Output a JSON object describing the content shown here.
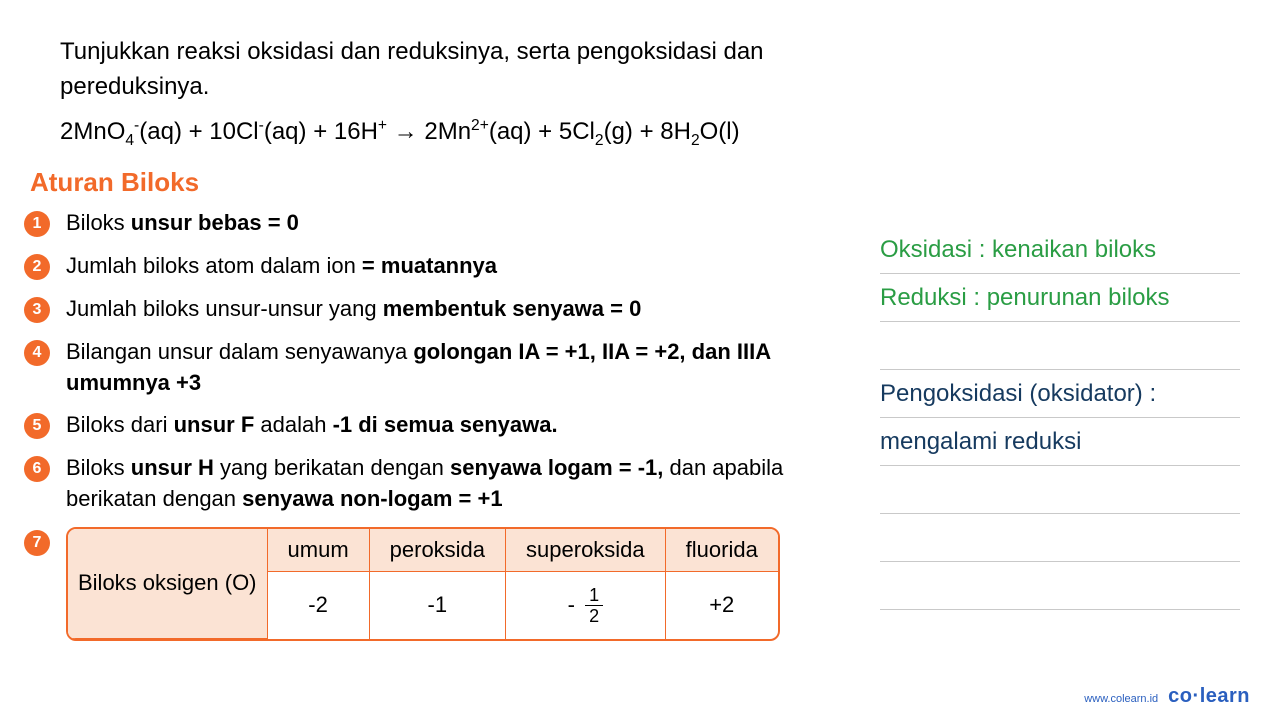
{
  "question": {
    "prompt": "Tunjukkan reaksi oksidasi dan reduksinya, serta pengoksidasi dan pereduksinya.",
    "equation_html": "2MnO<span class='sub'>4</span><span class='sup'>-</span>(aq) + 10Cl<span class='sup'>-</span>(aq) + 16H<span class='sup'>+</span> → 2Mn<span class='sup'>2+</span>(aq) + 5Cl<span class='sub'>2</span>(g) + 8H<span class='sub'>2</span>O(l)"
  },
  "section_title": "Aturan Biloks",
  "rules": [
    {
      "n": "1",
      "html": "Biloks <b>unsur bebas = 0</b>"
    },
    {
      "n": "2",
      "html": "Jumlah biloks atom dalam ion <b>= muatannya</b>"
    },
    {
      "n": "3",
      "html": "Jumlah biloks unsur-unsur yang <b>membentuk senyawa = 0</b>"
    },
    {
      "n": "4",
      "html": "Bilangan unsur dalam senyawanya <b>golongan IA = +1, IIA = +2, dan IIIA umumnya +3</b>"
    },
    {
      "n": "5",
      "html": "Biloks dari <b>unsur F</b> adalah <b>-1 di semua senyawa.</b>"
    },
    {
      "n": "6",
      "html": "Biloks <b>unsur H</b> yang berikatan dengan <b>senyawa logam = -1,</b> dan apabila berikatan dengan <b>senyawa non-logam = +1</b>"
    }
  ],
  "table": {
    "bullet": "7",
    "row_label": "Biloks oksigen (O)",
    "headers": [
      "umum",
      "peroksida",
      "superoksida",
      "fluorida"
    ],
    "values": [
      "-2",
      "-1",
      "-1/2",
      "+2"
    ]
  },
  "sidebar": {
    "oksidasi": "Oksidasi : kenaikan biloks",
    "reduksi": "Reduksi : penurunan biloks",
    "pengoksidasi": "Pengoksidasi (oksidator) :",
    "mengalami": "mengalami reduksi"
  },
  "footer": {
    "url": "www.colearn.id",
    "brand_co": "co",
    "brand_learn": "learn"
  }
}
